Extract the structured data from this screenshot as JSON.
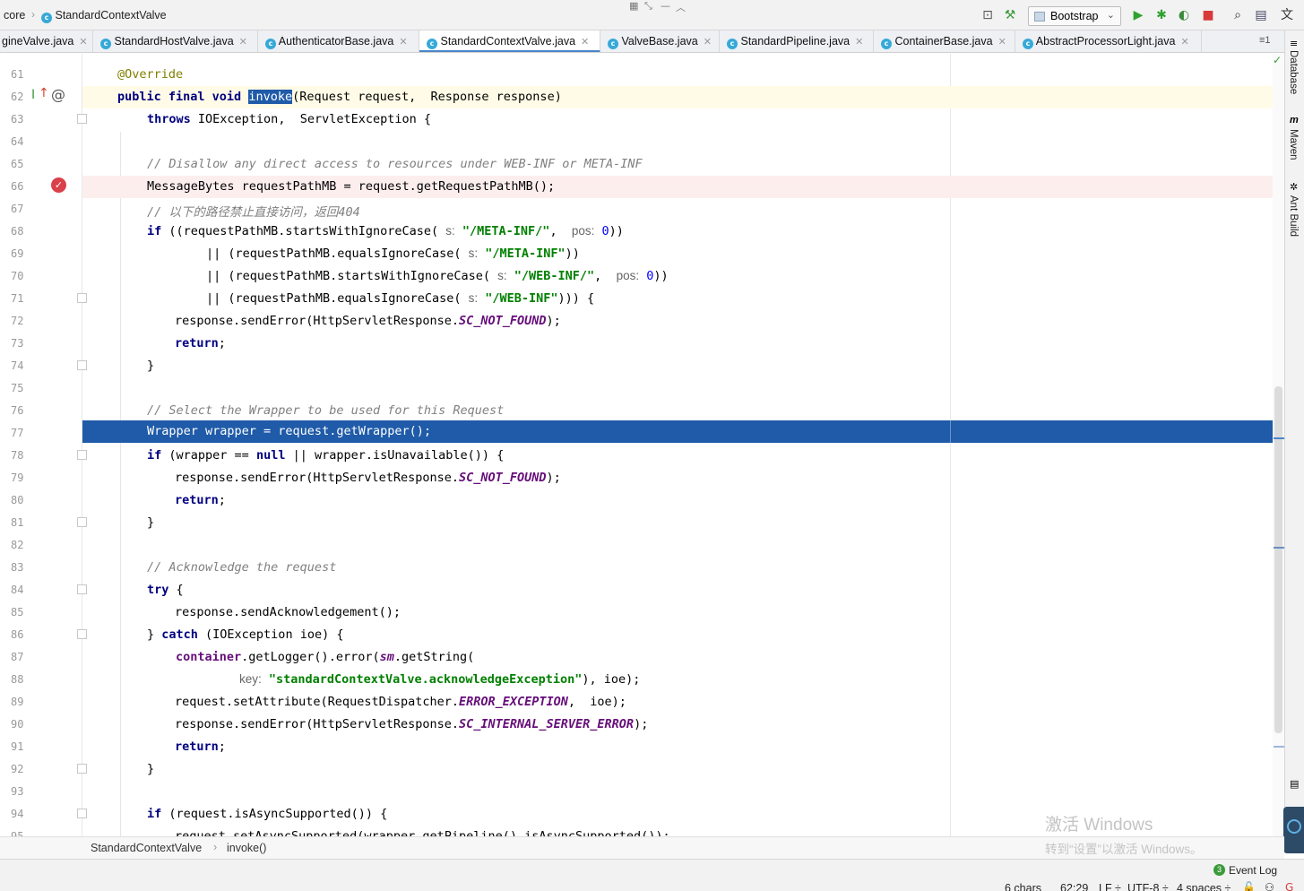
{
  "navbar": {
    "module": "core",
    "file": "StandardContextValve",
    "run_config": "Bootstrap",
    "tool_icons": [
      "layout-icon",
      "hammer-icon",
      "run-icon",
      "debug-icon",
      "coverage-icon",
      "stop-icon",
      "search-icon",
      "project-structure-icon",
      "translate-icon"
    ]
  },
  "tabs": [
    {
      "label": "gineValve.java",
      "icon": "c"
    },
    {
      "label": "StandardHostValve.java",
      "icon": "c"
    },
    {
      "label": "AuthenticatorBase.java",
      "icon": "c"
    },
    {
      "label": "StandardContextValve.java",
      "icon": "c",
      "active": true
    },
    {
      "label": "ValveBase.java",
      "icon": "c"
    },
    {
      "label": "StandardPipeline.java",
      "icon": "c"
    },
    {
      "label": "ContainerBase.java",
      "icon": "c"
    },
    {
      "label": "AbstractProcessorLight.java",
      "icon": "c"
    }
  ],
  "tab_menu": "≡1",
  "side_tools": [
    "Database",
    "Maven",
    "Ant Build"
  ],
  "code": {
    "line_numbers": [
      "61",
      "62",
      "63",
      "64",
      "65",
      "66",
      "67",
      "68",
      "69",
      "70",
      "71",
      "72",
      "73",
      "74",
      "75",
      "76",
      "77",
      "78",
      "79",
      "80",
      "81",
      "82",
      "83",
      "84",
      "85",
      "86",
      "87",
      "88",
      "89",
      "90",
      "91",
      "92",
      "93",
      "94",
      "95"
    ],
    "l61": "@Override",
    "l62_kw": "public final void",
    "l62_method": "invoke",
    "l62_rest": "(Request request,  Response response)",
    "l63_kw": "throws",
    "l63_rest": " IOException,  ServletException {",
    "l65": "// Disallow any direct access to resources under WEB-INF or META-INF",
    "l66": "MessageBytes requestPathMB = request.getRequestPathMB();",
    "l67": "// 以下的路径禁止直接访问，返回404",
    "l68_a": " ((requestPathMB.startsWithIgnoreCase( ",
    "l68_hint_s": "s:",
    "l68_str": "\"/META-INF/\"",
    "l68_hint_pos": "pos:",
    "l68_num": "0",
    "l68_end": "))",
    "l69_a": "|| (requestPathMB.equalsIgnoreCase( ",
    "l69_str": "\"/META-INF\"",
    "l69_end": "))",
    "l70_a": "|| (requestPathMB.startsWithIgnoreCase( ",
    "l70_str": "\"/WEB-INF/\"",
    "l70_end": "))",
    "l71_a": "|| (requestPathMB.equalsIgnoreCase( ",
    "l71_str": "\"/WEB-INF\"",
    "l71_end": "))) {",
    "l72_a": "response.sendError(HttpServletResponse.",
    "l72_fld": "SC_NOT_FOUND",
    "l72_end": ");",
    "kw_if": "if",
    "kw_return": "return",
    "semi": ";",
    "close_brace": "}",
    "l76": "// Select the Wrapper to be used for this Request",
    "l77": "Wrapper wrapper = request.getWrapper();",
    "l78_a": " (wrapper == ",
    "l78_null": "null",
    "l78_b": " || wrapper.isUnavailable()) {",
    "l83": "// Acknowledge the request",
    "l84_kw": "try",
    "l84_rest": " {",
    "l85": "response.sendAcknowledgement();",
    "l86_a": "} ",
    "l86_kw": "catch",
    "l86_rest": " (IOException ioe) {",
    "l87_fld": "container",
    "l87_a": ".getLogger().error(",
    "l87_sm": "sm",
    "l87_b": ".getString(",
    "l88_hint": "key:",
    "l88_str": "\"standardContextValve.acknowledgeException\"",
    "l88_end": "), ioe);",
    "l89_a": "request.setAttribute(RequestDispatcher.",
    "l89_fld": "ERROR_EXCEPTION",
    "l89_end": ",  ioe);",
    "l90_a": "response.sendError(HttpServletResponse.",
    "l90_fld": "SC_INTERNAL_SERVER_ERROR",
    "l90_end": ");",
    "l94_rest": " (request.isAsyncSupported()) {",
    "l95": "request.setAsyncSupported(wrapper.getPipeline().isAsyncSupported());"
  },
  "breadcrumb": {
    "class": "StandardContextValve",
    "method": "invoke()"
  },
  "status": {
    "event_log": "Event Log",
    "event_count": "3",
    "chars": "6 chars",
    "position": "62:29",
    "line_sep": "LF ÷",
    "encoding": "UTF-8 ÷",
    "indent": "4 spaces ÷"
  },
  "watermark": {
    "line1": "激活 Windows",
    "line2": "转到“设置”以激活 Windows。"
  },
  "colors": {
    "selection": "#1f5ba8",
    "breakpoint_line": "#fdeeee",
    "caret_line": "#fffbe7"
  }
}
